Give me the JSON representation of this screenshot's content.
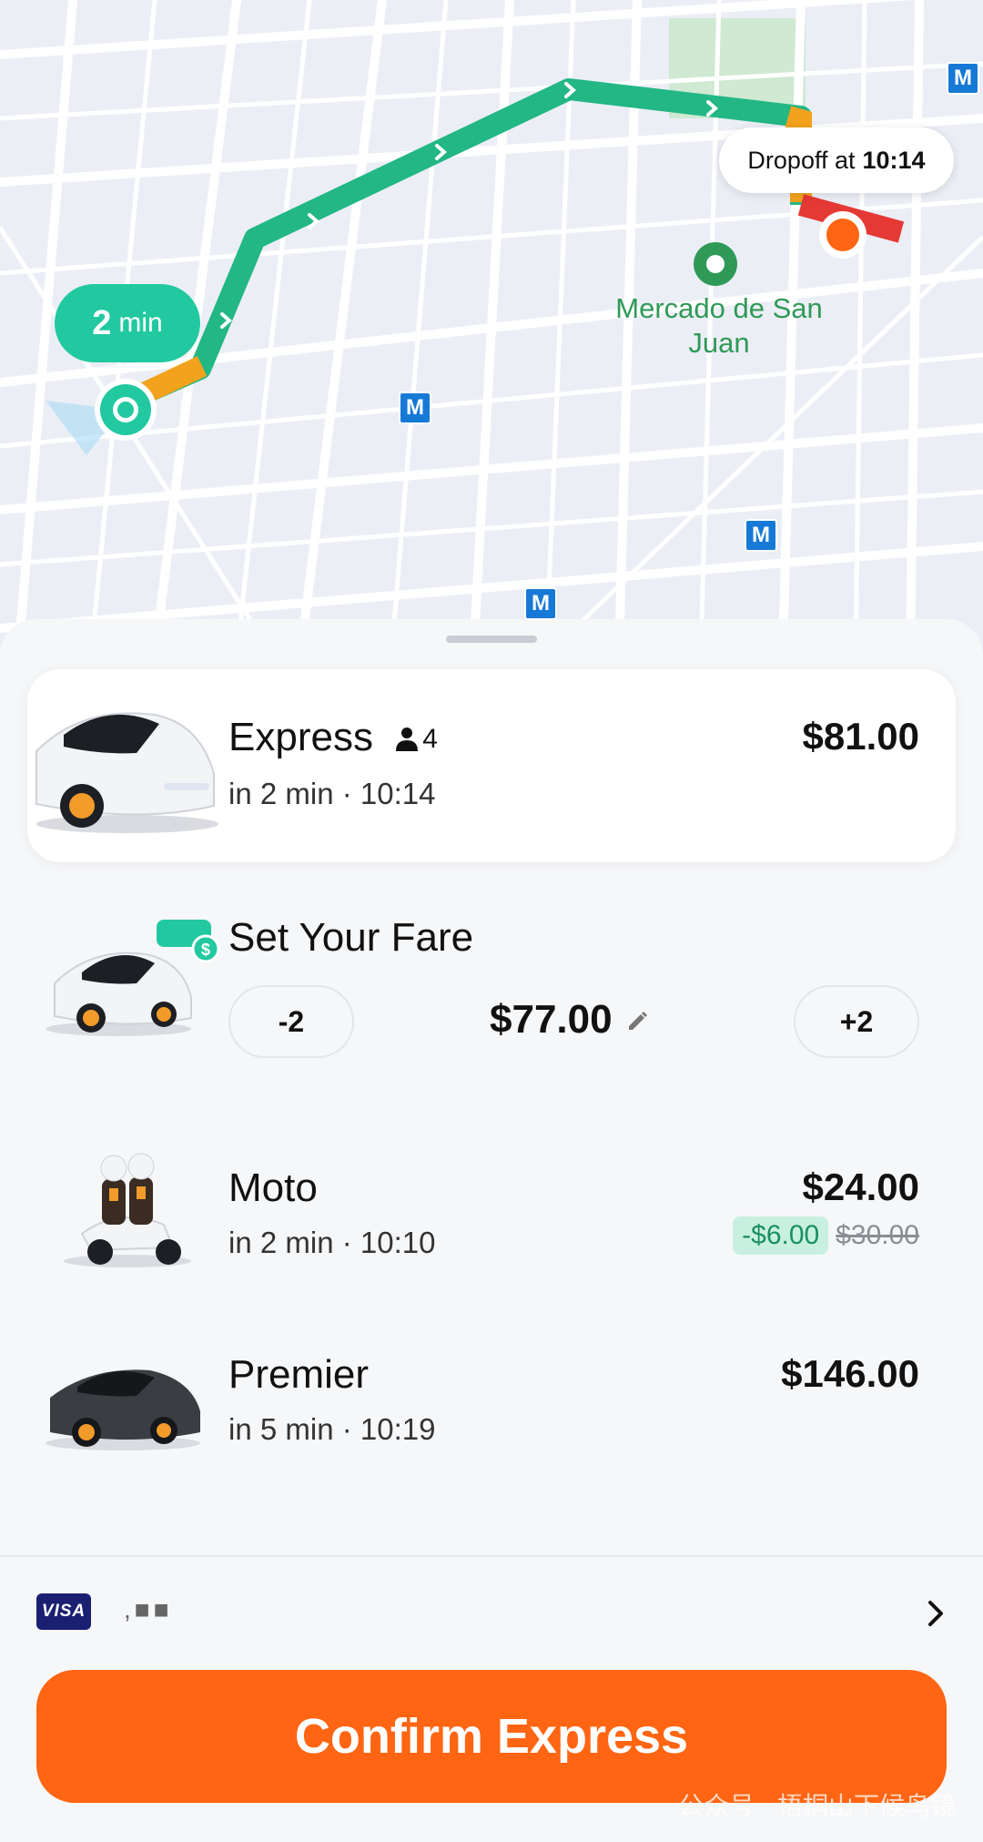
{
  "map": {
    "eta_pill": {
      "value": "2",
      "unit": "min"
    },
    "dropoff": {
      "prefix": "Dropoff at",
      "time": "10:14"
    },
    "poi_label": "Mercado de San Juan",
    "metro_letter": "M",
    "colors": {
      "route": "#22b785",
      "route_slow": "#f2a21c",
      "route_jam": "#e53935",
      "pickup": "#22c9a0",
      "dropoff": "#ff6512"
    }
  },
  "rides": [
    {
      "name": "Express",
      "seats": "4",
      "eta": "in 2 min · 10:14",
      "price": "$81.00",
      "selected": true,
      "icon": "white-sedan-icon"
    },
    {
      "name": "Set Your Fare",
      "fare": "$77.00",
      "minus": "-2",
      "plus": "+2",
      "icon": "white-sedan-handshake-icon"
    },
    {
      "name": "Moto",
      "eta": "in 2 min · 10:10",
      "price": "$24.00",
      "discount": "-$6.00",
      "original": "$30.00",
      "icon": "motorbike-icon"
    },
    {
      "name": "Premier",
      "eta": "in 5 min · 10:19",
      "price": "$146.00",
      "icon": "dark-sedan-icon"
    }
  ],
  "payment": {
    "brand": "VISA",
    "masked": ",■■"
  },
  "confirm_label": "Confirm Express",
  "watermark": "公众号 · 梧桐山下候鸟镜",
  "accent": "#ff6512"
}
